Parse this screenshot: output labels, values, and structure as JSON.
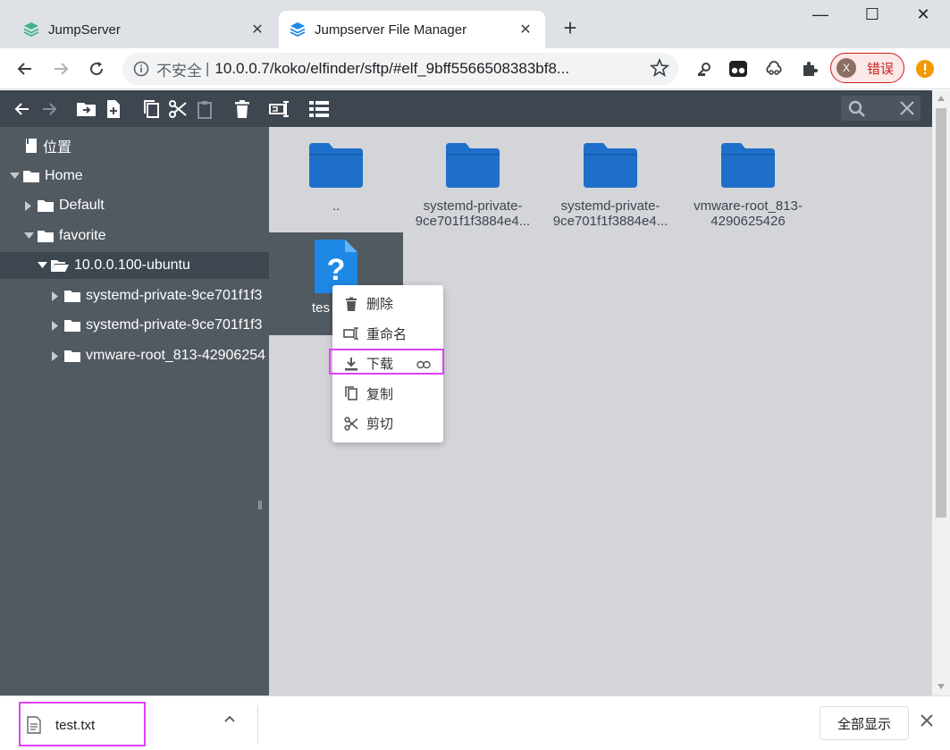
{
  "browser": {
    "tabs": [
      {
        "title": "JumpServer",
        "active": false
      },
      {
        "title": "Jumpserver File Manager",
        "active": true
      }
    ],
    "new_tab_label": "+",
    "window_controls": {
      "minimize": "—",
      "maximize": "☐",
      "close": "✕"
    },
    "security_label": "不安全",
    "separator": "|",
    "url": "10.0.0.7/koko/elfinder/sftp/#elf_9bff5566508383bf8...",
    "profile": {
      "initial": "X",
      "label": "错误"
    },
    "colors": {
      "accent": "#1e6fc9",
      "error": "#c5221f",
      "update": "#f29900"
    }
  },
  "elfinder": {
    "places_label": "位置",
    "tree": [
      {
        "label": "Home",
        "level": 0,
        "expanded": true
      },
      {
        "label": "Default",
        "level": 1,
        "expanded": false
      },
      {
        "label": "favorite",
        "level": 1,
        "expanded": true
      },
      {
        "label": "10.0.0.100-ubuntu",
        "level": 2,
        "expanded": true,
        "selected": true
      },
      {
        "label": "systemd-private-9ce701f1f3",
        "level": 3,
        "expanded": false
      },
      {
        "label": "systemd-private-9ce701f1f3",
        "level": 3,
        "expanded": false
      },
      {
        "label": "vmware-root_813-42906254",
        "level": 3,
        "expanded": false
      }
    ],
    "files": [
      {
        "name": "..",
        "type": "folder"
      },
      {
        "name_line1": "systemd-private-",
        "name_line2": "9ce701f1f3884e4...",
        "type": "folder"
      },
      {
        "name_line1": "systemd-private-",
        "name_line2": "9ce701f1f3884e4...",
        "type": "folder"
      },
      {
        "name_line1": "vmware-root_813-",
        "name_line2": "4290625426",
        "type": "folder"
      },
      {
        "name": "tes",
        "type": "unknown",
        "selected": true
      }
    ],
    "context_menu": [
      {
        "label": "删除",
        "icon": "trash-icon"
      },
      {
        "label": "重命名",
        "icon": "rename-icon"
      },
      {
        "label": "下载",
        "icon": "download-icon",
        "highlighted": true
      },
      {
        "label": "复制",
        "icon": "copy-icon"
      },
      {
        "label": "剪切",
        "icon": "cut-icon"
      }
    ]
  },
  "downloads": {
    "file_name": "test.txt",
    "show_all_label": "全部显示"
  }
}
